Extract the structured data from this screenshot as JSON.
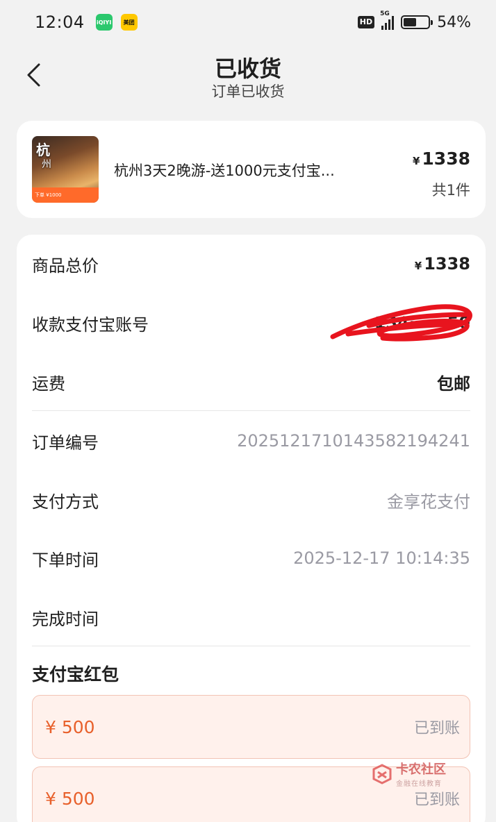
{
  "status_bar": {
    "time": "12:04",
    "apps": [
      "iQIYI",
      "美团"
    ],
    "hd": "HD",
    "network": "5G",
    "battery_percent": "54%",
    "battery_level": 0.54
  },
  "header": {
    "title": "已收货",
    "subtitle": "订单已收货",
    "back_icon": "chevron-left-icon"
  },
  "product": {
    "thumb_text": "杭州",
    "thumb_text2": "州",
    "thumb_tag": "¥1000",
    "name": "杭州3天2晚游-送1000元支付宝...",
    "currency": "¥",
    "price": "1338",
    "quantity": "共1件"
  },
  "details": {
    "total_label": "商品总价",
    "total_currency": "¥",
    "total_value": "1338",
    "alipay_label": "收款支付宝账号",
    "alipay_value": "134······50",
    "shipping_label": "运费",
    "shipping_value": "包邮",
    "order_no_label": "订单编号",
    "order_no_value": "20251217101435821942 41",
    "pay_method_label": "支付方式",
    "pay_method_value": "金享花支付",
    "order_time_label": "下单时间",
    "order_time_value": "2025-12-17 10:14:35",
    "complete_time_label": "完成时间",
    "complete_time_value": ""
  },
  "redpacks": {
    "title": "支付宝红包",
    "items": [
      {
        "amount": "¥ 500",
        "status": "已到账"
      },
      {
        "amount": "¥ 500",
        "status": "已到账"
      }
    ]
  },
  "watermark": {
    "main": "卡农社区",
    "sub": "金融在线教育"
  },
  "colors": {
    "accent": "#e8602b",
    "muted": "#9a9aa3",
    "scribble": "#e8141e"
  }
}
